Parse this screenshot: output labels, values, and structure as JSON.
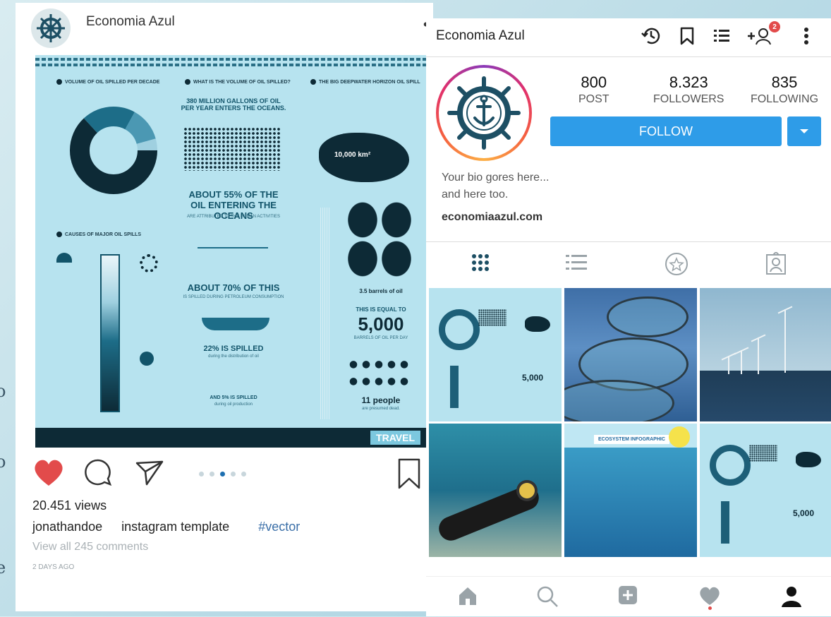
{
  "background_fragments": [
    "o",
    "o",
    "e"
  ],
  "post": {
    "username": "Economia Azul",
    "more_icon": "more-horizontal-icon",
    "image": {
      "brand": "TRAVEL",
      "col1_title": "Volume of oil spilled per decade",
      "col1_title2": "Causes of major oil spills",
      "col2_title": "What is the volume of oil spilled?",
      "col3_title": "The big deepwater horizon oil spill",
      "headline1": "380 MILLION GALLONS OF OIL PER YEAR ENTERS THE OCEANS.",
      "headline2": "ABOUT 55% OF THE OIL ENTERING THE OCEANS",
      "headline2_sub": "ARE ATTRIBUTED TO THE HUMAN ACTIVITIES",
      "headline3": "ABOUT 70% OF THIS",
      "headline3_sub": "IS SPILLED DURING PETROLEUM CONSUMPTION",
      "headline4": "22% IS SPILLED",
      "headline4_sub": "during the distribution of oil",
      "headline5": "AND 5% IS SPILLED",
      "headline5_sub": "during oil production",
      "area": "10,000 km²",
      "barrels_label": "3.5 barrels of oil",
      "equal_to": "THIS IS EQUAL TO",
      "big_number": "5,000",
      "big_number_sub": "BARRELS OF OIL PER DAY",
      "people": "11 people",
      "people_sub": "are presumed dead."
    },
    "actions": {
      "like_icon": "heart-filled-icon",
      "comment_icon": "comment-icon",
      "share_icon": "send-icon",
      "save_icon": "bookmark-icon"
    },
    "carousel": {
      "count": 5,
      "active": 3
    },
    "views": "20.451 views",
    "caption_user": "jonathandoe",
    "caption_text": "instagram template",
    "caption_tag": "#vector",
    "comments_link": "View all 245 comments",
    "time": "2 DAYS AGO"
  },
  "profile": {
    "name": "Economia Azul",
    "top_icons": [
      "history-icon",
      "bookmark-icon",
      "list-icon",
      "add-user-icon",
      "more-vertical-icon"
    ],
    "notification_count": "2",
    "stats": [
      {
        "value": "800",
        "label": "POST"
      },
      {
        "value": "8.323",
        "label": "FOLLOWERS"
      },
      {
        "value": "835",
        "label": "FOLLOWING"
      }
    ],
    "follow_label": "FOLLOW",
    "bio_line1": "Your bio gores here...",
    "bio_line2": "and here too.",
    "website": "economiaazul.com",
    "tabs": [
      "grid-icon",
      "list-icon",
      "star-icon",
      "tagged-user-icon"
    ],
    "grid_labels": {
      "eco_title": "ECOSYSTEM INFOGRAPHIC",
      "mini_number": "5,000"
    },
    "nav": [
      "home-icon",
      "search-icon",
      "add-post-icon",
      "heart-icon",
      "profile-icon"
    ],
    "colors": {
      "accent": "#2e9ce8",
      "like": "#e24b4b",
      "teal": "#12546a"
    }
  }
}
